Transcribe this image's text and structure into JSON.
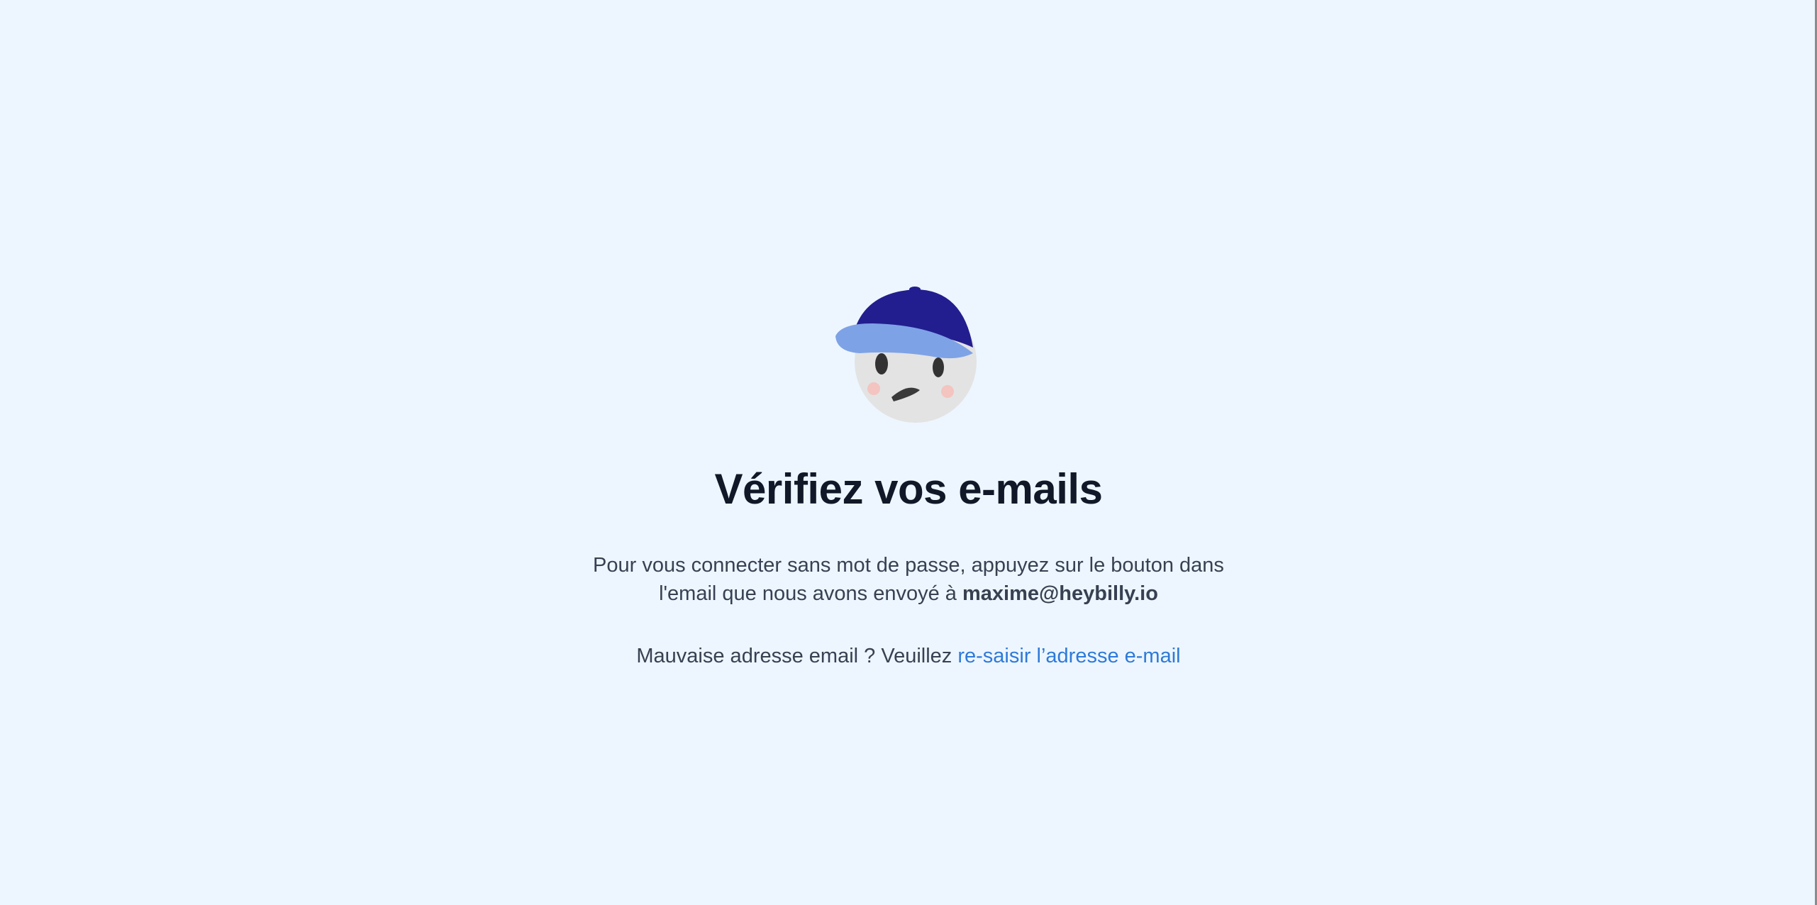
{
  "mascot": {
    "icon": "billy-cap-mascot-icon"
  },
  "title": "Vérifiez vos e-mails",
  "description": {
    "line1": "Pour vous connecter sans mot de passe, appuyez sur le bouton dans",
    "line2_prefix": "l'email que nous avons envoyé à ",
    "email": "maxime@heybilly.io"
  },
  "wrong_email": {
    "prefix": "Mauvaise adresse email ? Veuillez ",
    "link_label": "re-saisir l’adresse e-mail"
  },
  "colors": {
    "background": "#edf6ff",
    "title": "#111827",
    "text": "#374151",
    "link": "#2e7ad8",
    "cap_dark": "#221e8f",
    "cap_light": "#7ea2e6",
    "face": "#e3e3e3"
  }
}
